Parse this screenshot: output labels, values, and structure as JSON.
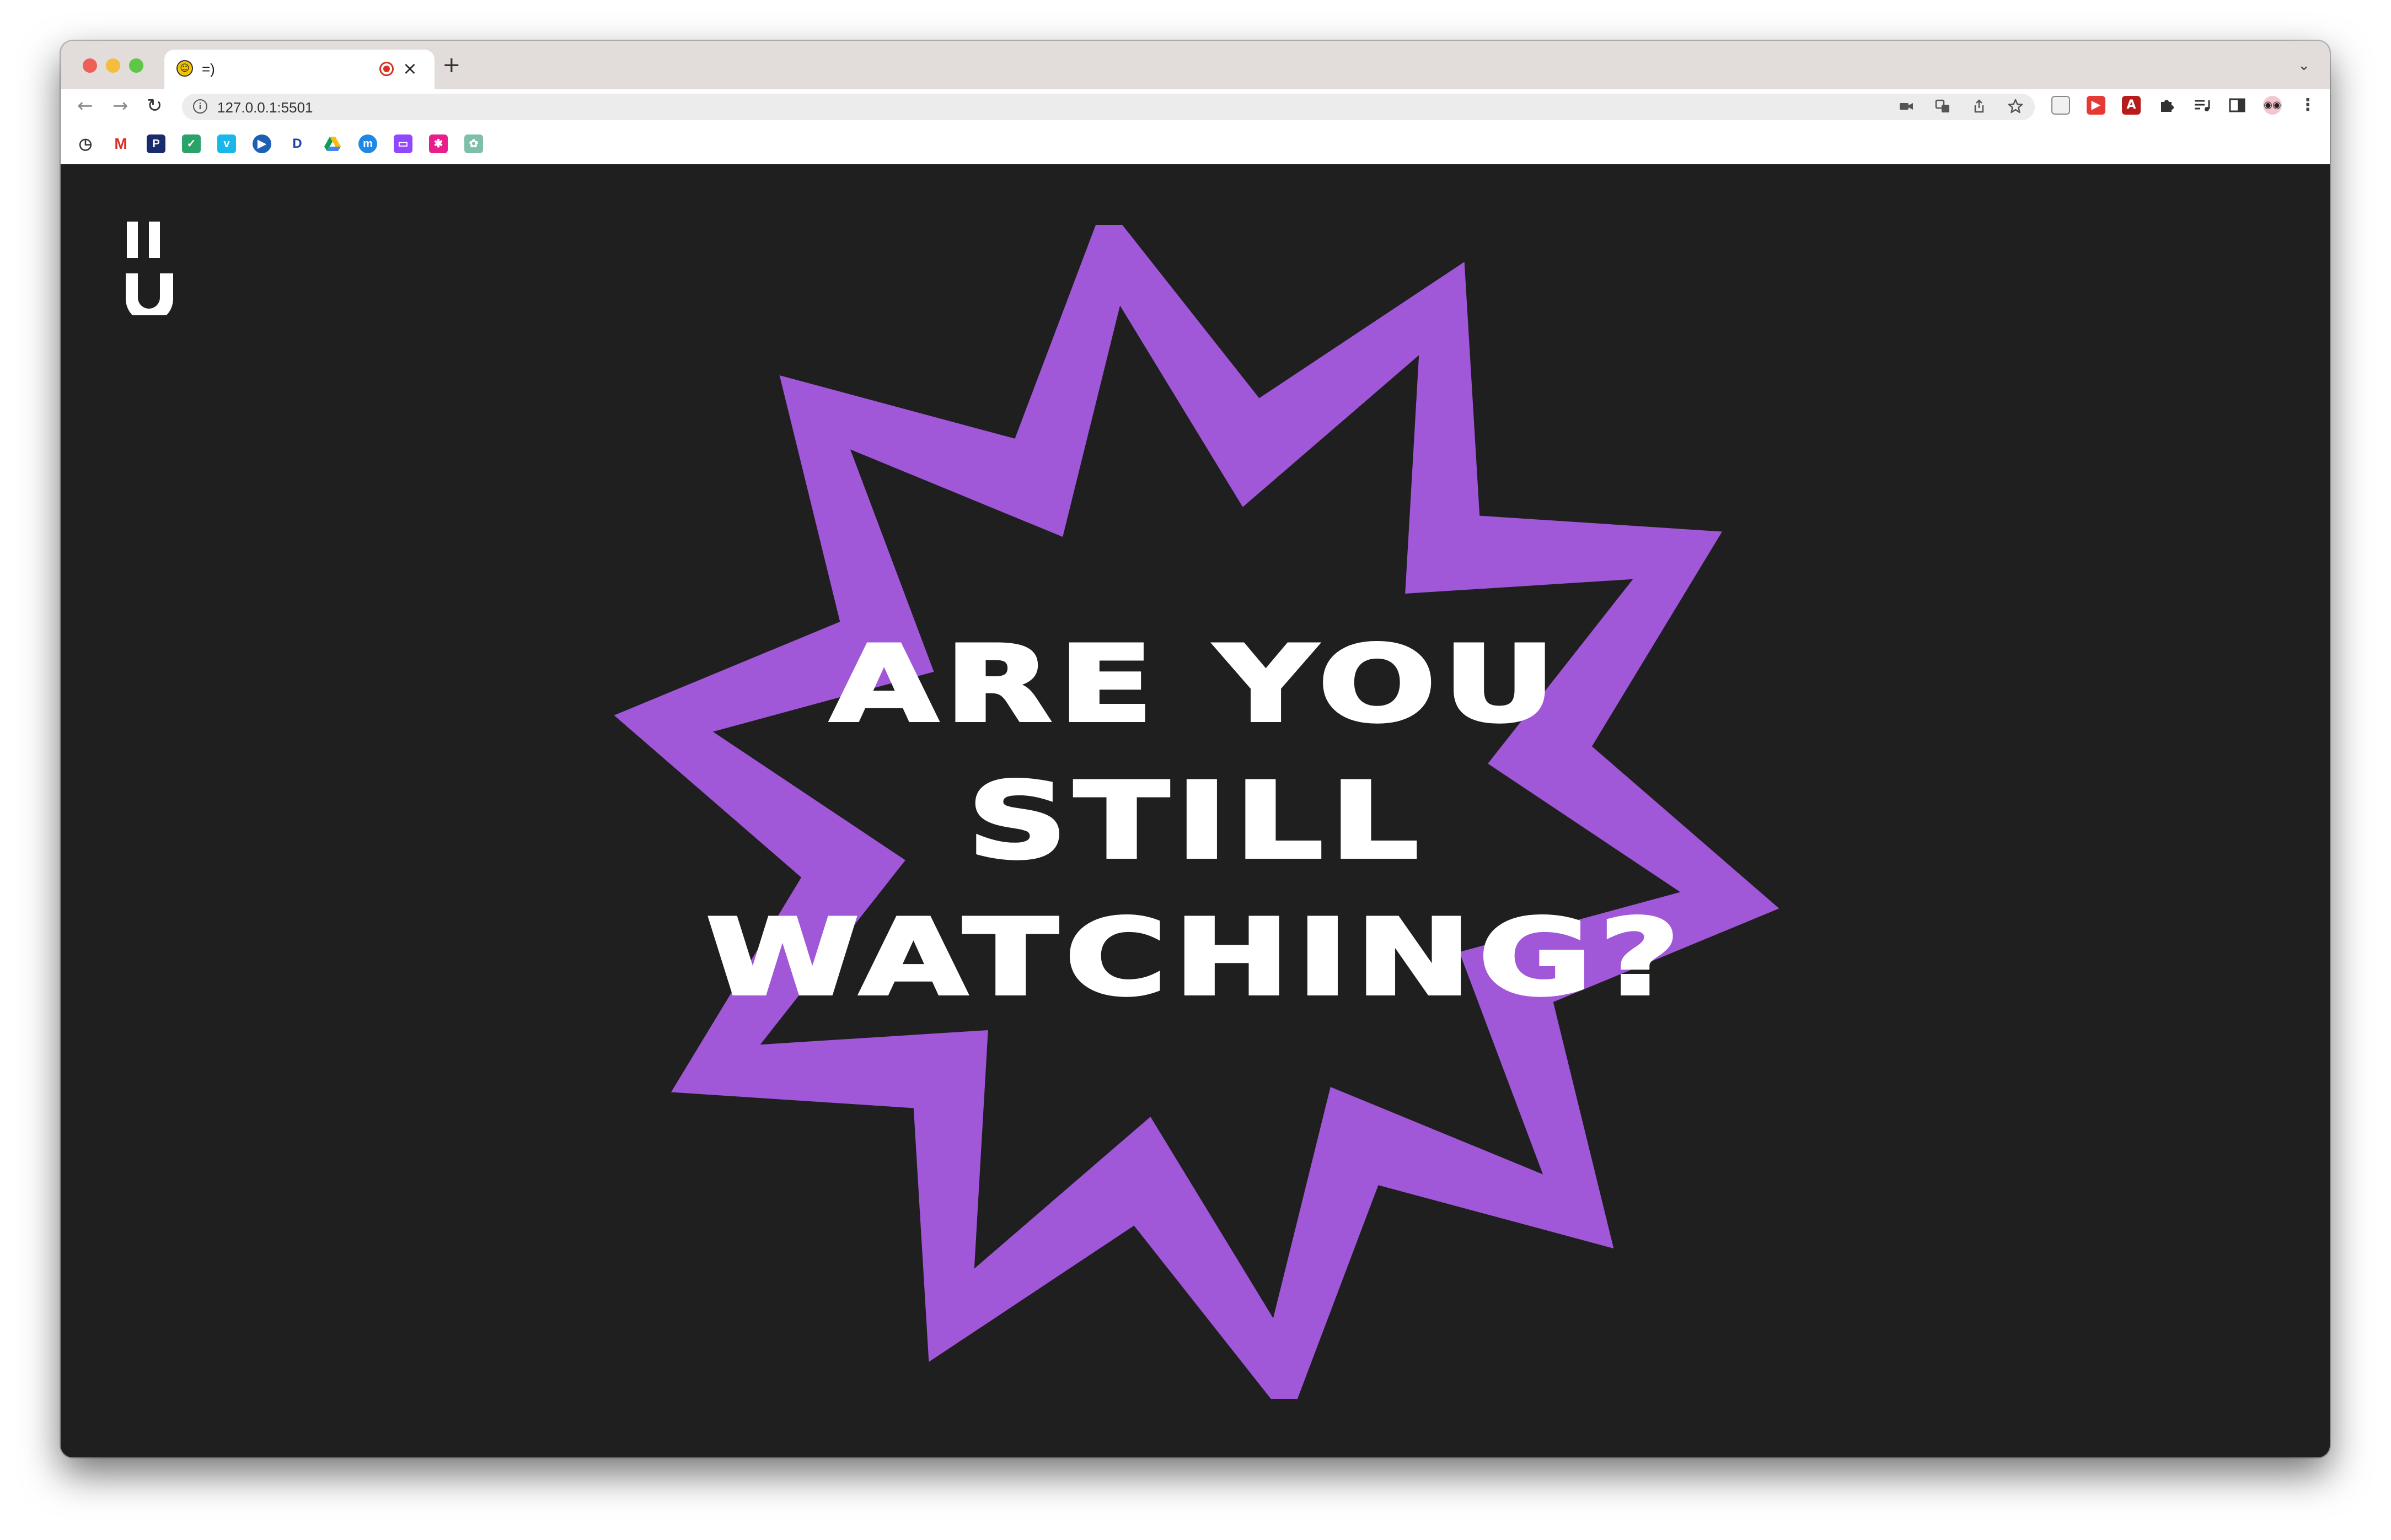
{
  "browser": {
    "tab": {
      "title": "=)",
      "favicon": "smiley-face-icon",
      "recording_indicator": "recording-dot-icon",
      "close_glyph": "×"
    },
    "new_tab_glyph": "+",
    "tab_search_glyph": "⌄",
    "toolbar": {
      "back_glyph": "←",
      "forward_glyph": "→",
      "reload_glyph": "↻",
      "url": "127.0.0.1:5501",
      "info_glyph": "i"
    }
  },
  "page": {
    "logo": "‖ ∪",
    "headline": [
      "ARE YOU",
      "STILL",
      "WATCHING?"
    ],
    "colors": {
      "background": "#1f1f1f",
      "star": "#a057d8",
      "text": "#ffffff"
    }
  }
}
